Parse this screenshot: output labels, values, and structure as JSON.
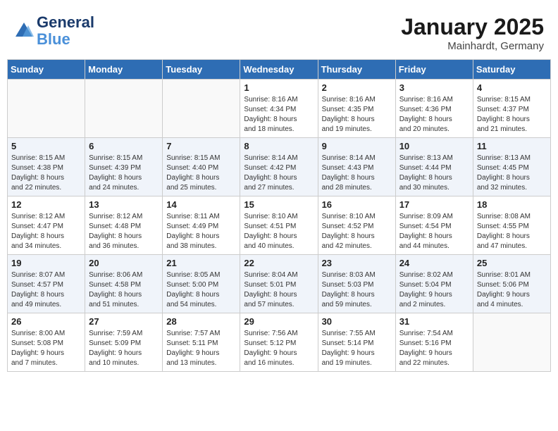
{
  "header": {
    "logo_line1": "General",
    "logo_line2": "Blue",
    "month": "January 2025",
    "location": "Mainhardt, Germany"
  },
  "weekdays": [
    "Sunday",
    "Monday",
    "Tuesday",
    "Wednesday",
    "Thursday",
    "Friday",
    "Saturday"
  ],
  "weeks": [
    [
      {
        "day": "",
        "info": ""
      },
      {
        "day": "",
        "info": ""
      },
      {
        "day": "",
        "info": ""
      },
      {
        "day": "1",
        "info": "Sunrise: 8:16 AM\nSunset: 4:34 PM\nDaylight: 8 hours\nand 18 minutes."
      },
      {
        "day": "2",
        "info": "Sunrise: 8:16 AM\nSunset: 4:35 PM\nDaylight: 8 hours\nand 19 minutes."
      },
      {
        "day": "3",
        "info": "Sunrise: 8:16 AM\nSunset: 4:36 PM\nDaylight: 8 hours\nand 20 minutes."
      },
      {
        "day": "4",
        "info": "Sunrise: 8:15 AM\nSunset: 4:37 PM\nDaylight: 8 hours\nand 21 minutes."
      }
    ],
    [
      {
        "day": "5",
        "info": "Sunrise: 8:15 AM\nSunset: 4:38 PM\nDaylight: 8 hours\nand 22 minutes."
      },
      {
        "day": "6",
        "info": "Sunrise: 8:15 AM\nSunset: 4:39 PM\nDaylight: 8 hours\nand 24 minutes."
      },
      {
        "day": "7",
        "info": "Sunrise: 8:15 AM\nSunset: 4:40 PM\nDaylight: 8 hours\nand 25 minutes."
      },
      {
        "day": "8",
        "info": "Sunrise: 8:14 AM\nSunset: 4:42 PM\nDaylight: 8 hours\nand 27 minutes."
      },
      {
        "day": "9",
        "info": "Sunrise: 8:14 AM\nSunset: 4:43 PM\nDaylight: 8 hours\nand 28 minutes."
      },
      {
        "day": "10",
        "info": "Sunrise: 8:13 AM\nSunset: 4:44 PM\nDaylight: 8 hours\nand 30 minutes."
      },
      {
        "day": "11",
        "info": "Sunrise: 8:13 AM\nSunset: 4:45 PM\nDaylight: 8 hours\nand 32 minutes."
      }
    ],
    [
      {
        "day": "12",
        "info": "Sunrise: 8:12 AM\nSunset: 4:47 PM\nDaylight: 8 hours\nand 34 minutes."
      },
      {
        "day": "13",
        "info": "Sunrise: 8:12 AM\nSunset: 4:48 PM\nDaylight: 8 hours\nand 36 minutes."
      },
      {
        "day": "14",
        "info": "Sunrise: 8:11 AM\nSunset: 4:49 PM\nDaylight: 8 hours\nand 38 minutes."
      },
      {
        "day": "15",
        "info": "Sunrise: 8:10 AM\nSunset: 4:51 PM\nDaylight: 8 hours\nand 40 minutes."
      },
      {
        "day": "16",
        "info": "Sunrise: 8:10 AM\nSunset: 4:52 PM\nDaylight: 8 hours\nand 42 minutes."
      },
      {
        "day": "17",
        "info": "Sunrise: 8:09 AM\nSunset: 4:54 PM\nDaylight: 8 hours\nand 44 minutes."
      },
      {
        "day": "18",
        "info": "Sunrise: 8:08 AM\nSunset: 4:55 PM\nDaylight: 8 hours\nand 47 minutes."
      }
    ],
    [
      {
        "day": "19",
        "info": "Sunrise: 8:07 AM\nSunset: 4:57 PM\nDaylight: 8 hours\nand 49 minutes."
      },
      {
        "day": "20",
        "info": "Sunrise: 8:06 AM\nSunset: 4:58 PM\nDaylight: 8 hours\nand 51 minutes."
      },
      {
        "day": "21",
        "info": "Sunrise: 8:05 AM\nSunset: 5:00 PM\nDaylight: 8 hours\nand 54 minutes."
      },
      {
        "day": "22",
        "info": "Sunrise: 8:04 AM\nSunset: 5:01 PM\nDaylight: 8 hours\nand 57 minutes."
      },
      {
        "day": "23",
        "info": "Sunrise: 8:03 AM\nSunset: 5:03 PM\nDaylight: 8 hours\nand 59 minutes."
      },
      {
        "day": "24",
        "info": "Sunrise: 8:02 AM\nSunset: 5:04 PM\nDaylight: 9 hours\nand 2 minutes."
      },
      {
        "day": "25",
        "info": "Sunrise: 8:01 AM\nSunset: 5:06 PM\nDaylight: 9 hours\nand 4 minutes."
      }
    ],
    [
      {
        "day": "26",
        "info": "Sunrise: 8:00 AM\nSunset: 5:08 PM\nDaylight: 9 hours\nand 7 minutes."
      },
      {
        "day": "27",
        "info": "Sunrise: 7:59 AM\nSunset: 5:09 PM\nDaylight: 9 hours\nand 10 minutes."
      },
      {
        "day": "28",
        "info": "Sunrise: 7:57 AM\nSunset: 5:11 PM\nDaylight: 9 hours\nand 13 minutes."
      },
      {
        "day": "29",
        "info": "Sunrise: 7:56 AM\nSunset: 5:12 PM\nDaylight: 9 hours\nand 16 minutes."
      },
      {
        "day": "30",
        "info": "Sunrise: 7:55 AM\nSunset: 5:14 PM\nDaylight: 9 hours\nand 19 minutes."
      },
      {
        "day": "31",
        "info": "Sunrise: 7:54 AM\nSunset: 5:16 PM\nDaylight: 9 hours\nand 22 minutes."
      },
      {
        "day": "",
        "info": ""
      }
    ]
  ]
}
